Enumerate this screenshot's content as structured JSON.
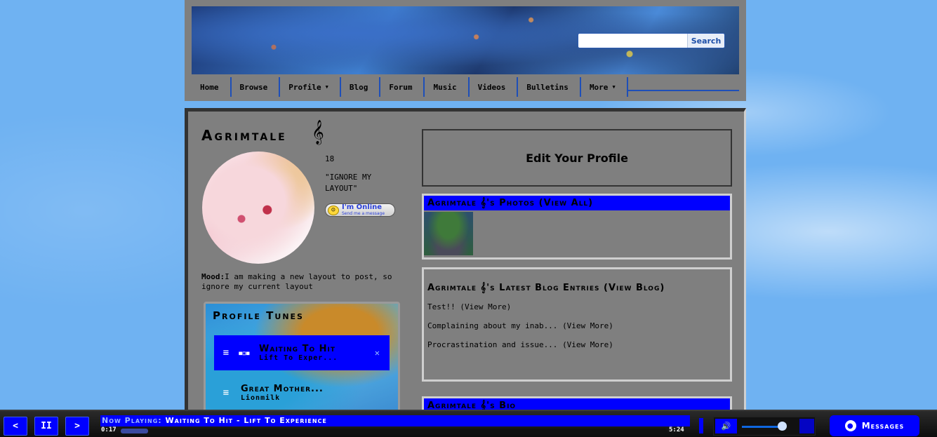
{
  "search": {
    "placeholder": "",
    "button_label": "Search"
  },
  "nav": {
    "items": [
      {
        "label": "Home",
        "dropdown": false
      },
      {
        "label": "Browse",
        "dropdown": false
      },
      {
        "label": "Profile",
        "dropdown": true
      },
      {
        "label": "Blog",
        "dropdown": false
      },
      {
        "label": "Forum",
        "dropdown": false
      },
      {
        "label": "Music",
        "dropdown": false
      },
      {
        "label": "Videos",
        "dropdown": false
      },
      {
        "label": "Bulletins",
        "dropdown": false
      },
      {
        "label": "More",
        "dropdown": true
      }
    ],
    "caret": "▼"
  },
  "profile": {
    "name": "Agrimtale",
    "clef": "𝄞",
    "age": "18",
    "quote": "\"IGNORE MY LAYOUT\"",
    "online_main": "I'm Online",
    "online_sub": "Send me a message",
    "mood_label": "Mood:",
    "mood_text": "I am making a new layout to post, so ignore my current layout"
  },
  "tunes": {
    "title": "Profile Tunes",
    "tracks": [
      {
        "title": "Waiting To Hit",
        "artist": "Lift To Exper..."
      },
      {
        "title": "Great Mother...",
        "artist": "Lionmilk"
      }
    ]
  },
  "edit_profile_label": "Edit Your Profile",
  "photos": {
    "heading": "Agrimtale 𝄞's Photos (View All)"
  },
  "blog": {
    "heading": "Agrimtale 𝄞's Latest Blog Entries (View Blog)",
    "entries": [
      {
        "title": "Test!!",
        "more": "(View More)"
      },
      {
        "title": "Complaining about my inab...",
        "more": "(View More)"
      },
      {
        "title": "Procrastination and issue...",
        "more": "(View More)"
      }
    ]
  },
  "bio": {
    "heading": "Agrimtale 𝄞's Bio"
  },
  "player": {
    "now_playing_label": "Now Playing:",
    "now_playing_track": "Waiting To Hit - Lift To Experience",
    "time_current": "0:17",
    "time_total": "5:24",
    "progress_percent": 5,
    "volume_percent": 90,
    "messages_label": "Messages",
    "prev_glyph": "<",
    "pause_glyph": "II",
    "next_glyph": ">"
  },
  "colors": {
    "accent": "#0000ff",
    "panel": "#7f7f7f",
    "background": "#6fb2f2"
  }
}
